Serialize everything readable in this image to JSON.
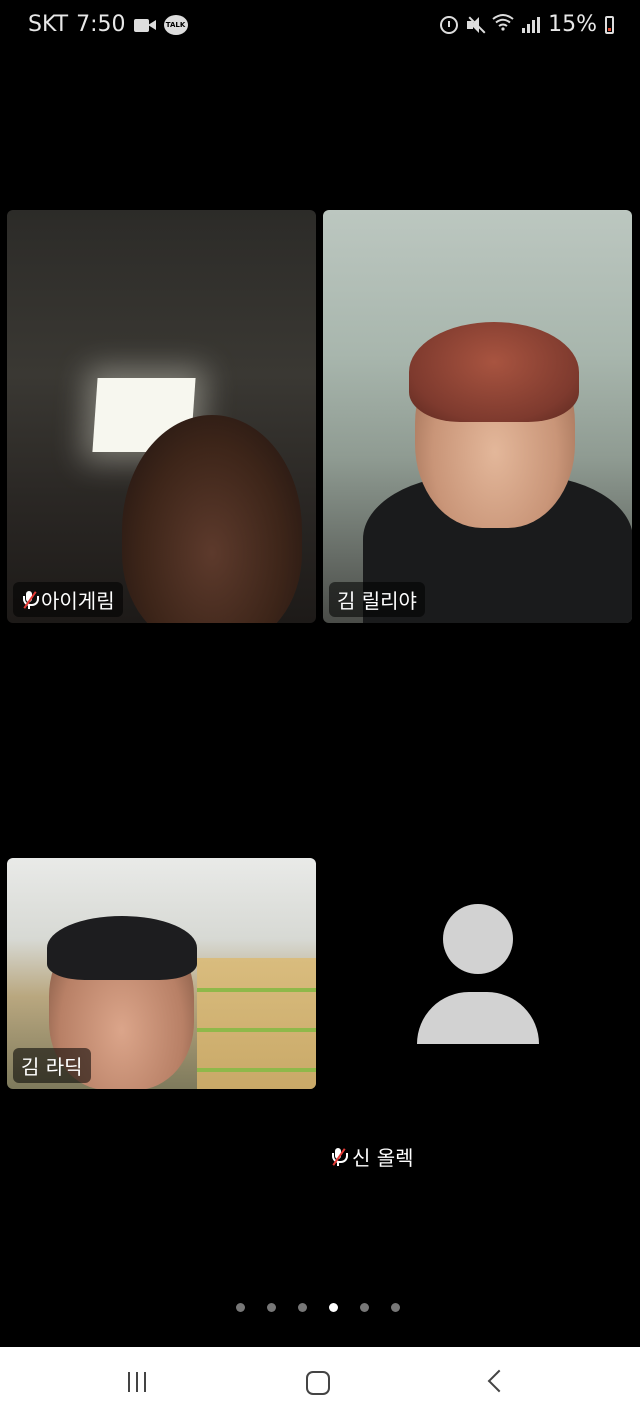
{
  "status_bar": {
    "carrier": "SKT",
    "time": "7:50",
    "battery": "15%",
    "left_icons": [
      "video-camera-icon",
      "kakaotalk-icon"
    ],
    "kakaotalk_label": "TALK",
    "right_icons": [
      "alarm-icon",
      "mute-icon",
      "wifi-icon",
      "signal-icon",
      "battery-icon"
    ],
    "battery_level_percent": 15,
    "battery_color": "#e04a2f"
  },
  "participants": [
    {
      "name": "아이게림",
      "muted": true,
      "video": true
    },
    {
      "name": "김 릴리야",
      "muted": false,
      "video": true
    },
    {
      "name": "김 라딕",
      "muted": false,
      "video": true
    },
    {
      "name": "신 올렉",
      "muted": true,
      "video": false
    }
  ],
  "pagination": {
    "total_pages": 6,
    "current_page": 4
  },
  "nav_bar": {
    "icons": [
      "recents-icon",
      "home-icon",
      "back-icon"
    ]
  },
  "colors": {
    "background": "#000000",
    "mute_slash": "#e53935",
    "avatar": "#d2d2d2",
    "dot_inactive": "#777777",
    "dot_active": "#ffffff"
  }
}
